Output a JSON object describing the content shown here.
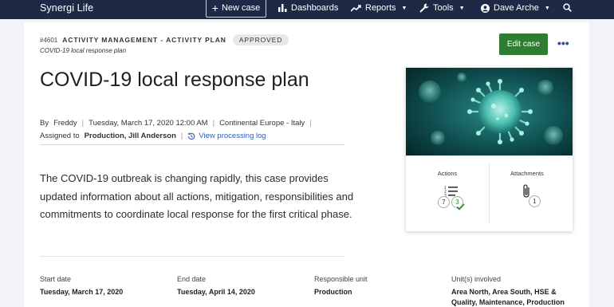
{
  "topbar": {
    "brand": "Synergi Life",
    "new_case": "New case",
    "dashboards": "Dashboards",
    "reports": "Reports",
    "tools": "Tools",
    "user": "Dave Arche"
  },
  "case": {
    "id": "#4601",
    "type": "ACTIVITY MANAGEMENT - ACTIVITY PLAN",
    "status": "APPROVED",
    "subtitle": "COVID-19 local response plan",
    "title": "COVID-19 local response plan",
    "by_label": "By",
    "author": "Freddy",
    "date": "Tuesday, March 17, 2020 12:00 AM",
    "location": "Continental Europe - Italy",
    "assigned_label": "Assigned to",
    "assigned": "Production, Jill Anderson",
    "processing_log": "View processing log",
    "description": "The COVID-19 outbreak is changing rapidly, this case provides updated information about all actions, mitigation, responsibilities and commitments to coordinate local response for the first critical phase."
  },
  "actions": {
    "edit": "Edit case",
    "more": "•••"
  },
  "card": {
    "actions_label": "Actions",
    "actions_total": "7",
    "actions_done": "3",
    "attachments_label": "Attachments",
    "attachments_count": "1"
  },
  "fields": {
    "start_label": "Start date",
    "start_value": "Tuesday, March 17, 2020",
    "end_label": "End date",
    "end_value": "Tuesday, April 14, 2020",
    "unit_label": "Responsible unit",
    "unit_value": "Production",
    "involved_label": "Unit(s) involved",
    "involved_line1": "Area North, Area South, HSE &",
    "involved_line2": "Quality, Maintenance, Production"
  },
  "colors": {
    "topbar": "#1e2a45",
    "accent_green": "#2f7d32",
    "link_blue": "#2f5fb8"
  }
}
